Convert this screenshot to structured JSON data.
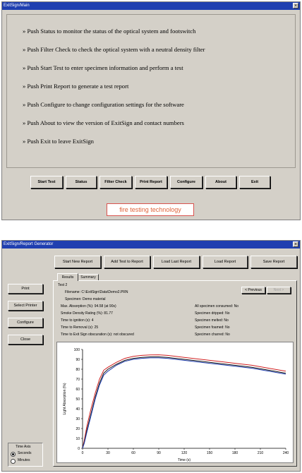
{
  "main_window": {
    "title": "ExitSign/Main",
    "instructions": [
      "» Push Status to monitor the status of the optical system and footswitch",
      "» Push Filter Check to check the optical system with a neutral density filter",
      "» Push Start Test to enter specimen information and perform a test",
      "» Push Print Report to generate a test report",
      "» Push Configure to change configuration settings for the software",
      "» Push About to view the version of ExitSign and contact numbers",
      "» Push Exit to leave ExitSign"
    ],
    "buttons": [
      "Start Test",
      "Status",
      "Filter Check",
      "Print Report",
      "Configure",
      "About",
      "Exit"
    ],
    "brand": "fire testing technology"
  },
  "report_window": {
    "title": "ExitSign/Report Generator",
    "top_buttons": [
      "Start New Report",
      "Add Test to Report",
      "Load Last Report",
      "Load Report",
      "Save Report"
    ],
    "tabs": [
      "Results",
      "Summary"
    ],
    "left_buttons": [
      "Print",
      "Select Printer",
      "Configure",
      "Close"
    ],
    "nav": {
      "previous": "< Previous",
      "next": "Next >"
    },
    "results": {
      "test_name": "Test 2",
      "filename": "Filename: C:\\ExitSign\\Data\\Demo2.PRN",
      "specimen": "Specimen: Demo material",
      "max_absorption": "Max. Absorption (%): 94.58 (at 90s)",
      "smoke_density": "Smoke Density Rating (%): 81.77",
      "time_to_ignition": "Time to ignition (s): 4",
      "time_to_removal": "Time to Removal (s): 25",
      "time_to_obscuration": "Time to Exit Sign obscuration (s): not obscured",
      "all_consumed": "All specimen consumed: No",
      "dripped": "Specimen dripped: No",
      "melted": "Specimen melted: No",
      "foamed": "Specimen foamed: No",
      "charred": "Specimen charred: No"
    },
    "time_axis": {
      "title": "Time Axis",
      "options": [
        "Seconds",
        "Minutes"
      ],
      "selected": "Seconds"
    }
  },
  "chart_data": {
    "type": "line",
    "xlabel": "Time (s)",
    "ylabel": "Light Absorption (%)",
    "xlim": [
      0,
      240
    ],
    "ylim": [
      0,
      100
    ],
    "xticks": [
      "0",
      "30",
      "60",
      "90",
      "120",
      "150",
      "180",
      "210",
      "240"
    ],
    "yticks": [
      "0",
      "10",
      "20",
      "30",
      "40",
      "50",
      "60",
      "70",
      "80",
      "90",
      "100"
    ],
    "grid": false,
    "x": [
      0,
      2,
      5,
      10,
      15,
      20,
      25,
      30,
      40,
      50,
      60,
      70,
      80,
      90,
      100,
      110,
      120,
      140,
      160,
      180,
      200,
      220,
      240
    ],
    "series": [
      {
        "color": "#d02020",
        "values": [
          0,
          8,
          22,
          40,
          56,
          70,
          79,
          82,
          87,
          91,
          93,
          94,
          94.5,
          94.6,
          94,
          93,
          92,
          90,
          88,
          86,
          84,
          81,
          78
        ]
      },
      {
        "color": "#1a1a1a",
        "values": [
          0,
          6,
          18,
          35,
          52,
          66,
          76,
          80,
          85,
          89,
          91,
          92,
          92.5,
          92.5,
          92,
          91,
          90,
          88,
          86,
          84,
          82,
          79,
          76
        ]
      },
      {
        "color": "#1f3fb0",
        "values": [
          0,
          5,
          16,
          33,
          50,
          64,
          74,
          78,
          84,
          88,
          90,
          91,
          91.5,
          91.5,
          91,
          90,
          89,
          87,
          85,
          83,
          81,
          78,
          75
        ]
      }
    ]
  }
}
